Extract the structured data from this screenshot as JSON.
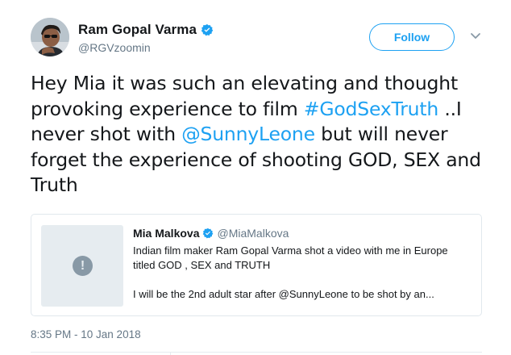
{
  "author": {
    "display_name": "Ram Gopal Varma",
    "handle": "@RGVzoomin",
    "verified": true
  },
  "follow_button": {
    "label": "Follow"
  },
  "tweet": {
    "text_parts": [
      "Hey Mia it was such an elevating and thought provoking experience to film ",
      "#GodSexTruth",
      " ..I never shot with ",
      "@SunnyLeone",
      " but will never forget the experience of shooting GOD, SEX and Truth"
    ]
  },
  "quoted_tweet": {
    "display_name": "Mia Malkova",
    "handle": "@MiaMalkova",
    "verified": true,
    "line1": "Indian film maker Ram Gopal Varma shot a video with me in Europe",
    "line2": "titled GOD , SEX and TRUTH",
    "line3": "I will be the 2nd adult star after @SunnyLeone to be shot by an...",
    "media_placeholder": "!"
  },
  "timestamp": "8:35 PM - 10 Jan 2018",
  "colors": {
    "accent": "#1da1f2",
    "text": "#14171a",
    "secondary_text": "#657786",
    "border": "#e1e8ed"
  },
  "icons": {
    "verified": "verified-badge-icon",
    "caret": "chevron-down-icon",
    "media": "sensitive-media-icon"
  }
}
